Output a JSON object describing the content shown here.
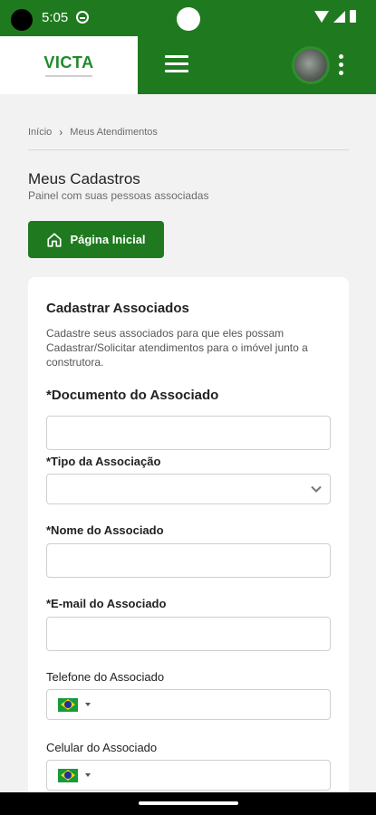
{
  "status_bar": {
    "time": "5:05"
  },
  "header": {
    "logo": "VICTA"
  },
  "breadcrumb": {
    "home": "Início",
    "separator": "›",
    "current": "Meus Atendimentos"
  },
  "page": {
    "title": "Meus Cadastros",
    "subtitle": "Painel com suas pessoas associadas",
    "home_button": "Página Inicial"
  },
  "card": {
    "title": "Cadastrar Associados",
    "description": "Cadastre seus associados para que eles possam Cadastrar/Solicitar atendimentos para o imóvel junto a construtora.",
    "fields": {
      "documento": {
        "label": "*Documento do Associado",
        "value": ""
      },
      "tipo": {
        "label": "*Tipo da Associação",
        "value": ""
      },
      "nome": {
        "label": "*Nome do Associado",
        "value": ""
      },
      "email": {
        "label": "*E-mail do Associado",
        "value": ""
      },
      "telefone": {
        "label": "Telefone do Associado",
        "value": ""
      },
      "celular": {
        "label": "Celular do Associado",
        "value": ""
      }
    }
  },
  "colors": {
    "brand_green": "#1f7a1f",
    "logo_green": "#1f8a2c"
  },
  "icons": {
    "menu": "hamburger-icon",
    "more": "kebab-icon",
    "home": "house-icon",
    "dropdown": "chevron-down-icon",
    "country": "brazil-flag-icon"
  }
}
